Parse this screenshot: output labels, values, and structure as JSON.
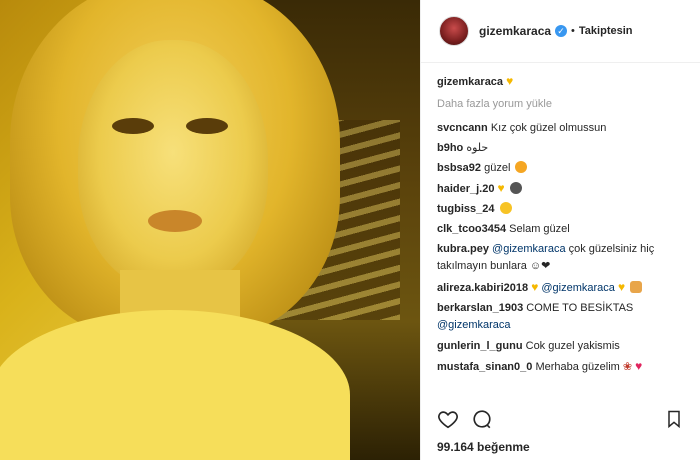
{
  "post": {
    "username": "gizemkaraca",
    "follow_status": "Takiptesin",
    "separator": "•",
    "load_more": "Daha fazla yorum yükle",
    "likes": "99.164 beğenme"
  },
  "comments": [
    {
      "user": "svcncann",
      "text": "Kız çok güzel olmussun"
    },
    {
      "user": "b9ho",
      "text": "حلوه"
    },
    {
      "user": "bsbsa92",
      "text": "güzel"
    },
    {
      "user": "haider_j.20",
      "text": ""
    },
    {
      "user": "tugbiss_24",
      "text": ""
    },
    {
      "user": "clk_tcoo3454",
      "text": "Selam güzel"
    },
    {
      "user": "kubra.pey",
      "mention": "@gizemkaraca",
      "text": "çok güzelsiniz hiç takılmayın bunlara ☺❤"
    },
    {
      "user": "alireza.kabiri2018",
      "mention": "@gizemkaraca",
      "text": ""
    },
    {
      "user": "berkarslan_1903",
      "text": "COME TO BESİKTAS",
      "mention": "@gizemkaraca"
    },
    {
      "user": "gunlerin_l_gunu",
      "text": "Cok guzel yakismis"
    },
    {
      "user": "mustafa_sinan0_0",
      "text": "Merhaba güzelim"
    }
  ],
  "icons": {
    "like": "heart-outline-icon",
    "comment": "comment-bubble-icon",
    "save": "bookmark-icon",
    "verified": "verified-badge-icon"
  },
  "colors": {
    "link": "#003569",
    "verified": "#3897f0",
    "muted": "#999999"
  }
}
